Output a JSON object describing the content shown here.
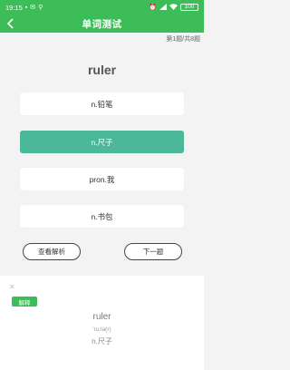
{
  "status": {
    "time": "19:15",
    "left_icons": [
      "square-icon",
      "mail-icon",
      "location-icon"
    ],
    "right_icons": [
      "alarm-icon",
      "signal-icon",
      "wifi-icon"
    ],
    "battery": "100"
  },
  "header": {
    "title": "单词测试"
  },
  "progress": "第1题/共8题",
  "question": {
    "word": "ruler",
    "options": [
      {
        "label": "n.铅笔",
        "selected": false
      },
      {
        "label": "n.尺子",
        "selected": true
      },
      {
        "label": "pron.我",
        "selected": false
      },
      {
        "label": "n.书包",
        "selected": false
      }
    ]
  },
  "buttons": {
    "view_explanation": "查看解析",
    "next": "下一题"
  },
  "explanation": {
    "badge": "解释",
    "word": "ruler",
    "phonetic": "'ru:lə(r)",
    "meaning": "n.尺子"
  },
  "colors": {
    "header": "#3dbd58",
    "selected_option": "#4cb89a"
  }
}
